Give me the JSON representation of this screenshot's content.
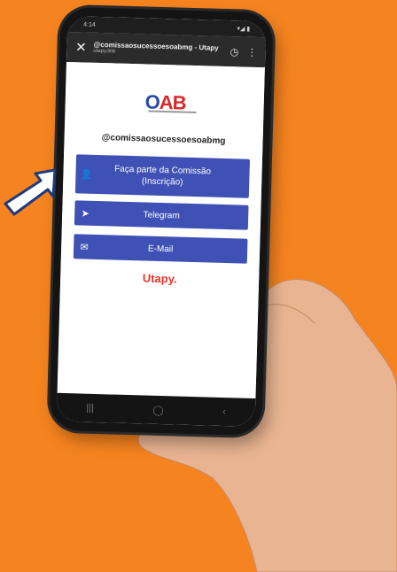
{
  "browser": {
    "title": "@comissaosucessoesoabmg - Utapy",
    "url": "utapy.link",
    "close_icon": "close-icon",
    "menu_icon": "more-vertical-icon"
  },
  "status_bar": {
    "time": "4:14",
    "right": "▾◢ ▮"
  },
  "profile": {
    "username": "@comissaosucessoesoabmg",
    "logo_text_o": "O",
    "logo_text_ab": "AB"
  },
  "links": [
    {
      "label": "Faça parte da Comissão (Inscrição)",
      "icon": "person-add-icon"
    },
    {
      "label": "Telegram",
      "icon": "telegram-icon"
    },
    {
      "label": "E-Mail",
      "icon": "mail-icon"
    }
  ],
  "brand": "Utapy.",
  "colors": {
    "background": "#f5831f",
    "button": "#3f51b5",
    "brand": "#e8342a"
  }
}
